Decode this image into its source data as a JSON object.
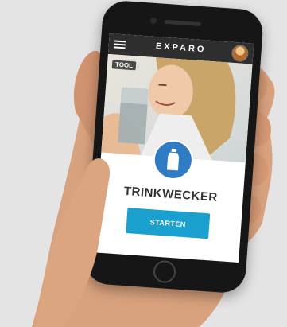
{
  "app": {
    "brand": "EXPARO",
    "badge": "TOOL",
    "title": "TRINKWECKER",
    "start_label": "STARTEN"
  },
  "colors": {
    "accent": "#1aa0cf",
    "bottle_circle": "#2f7cc4",
    "topbar": "#2e2e2e"
  },
  "icons": {
    "menu": "hamburger-menu-icon",
    "avatar": "user-avatar",
    "bottle": "water-bottle-icon"
  }
}
